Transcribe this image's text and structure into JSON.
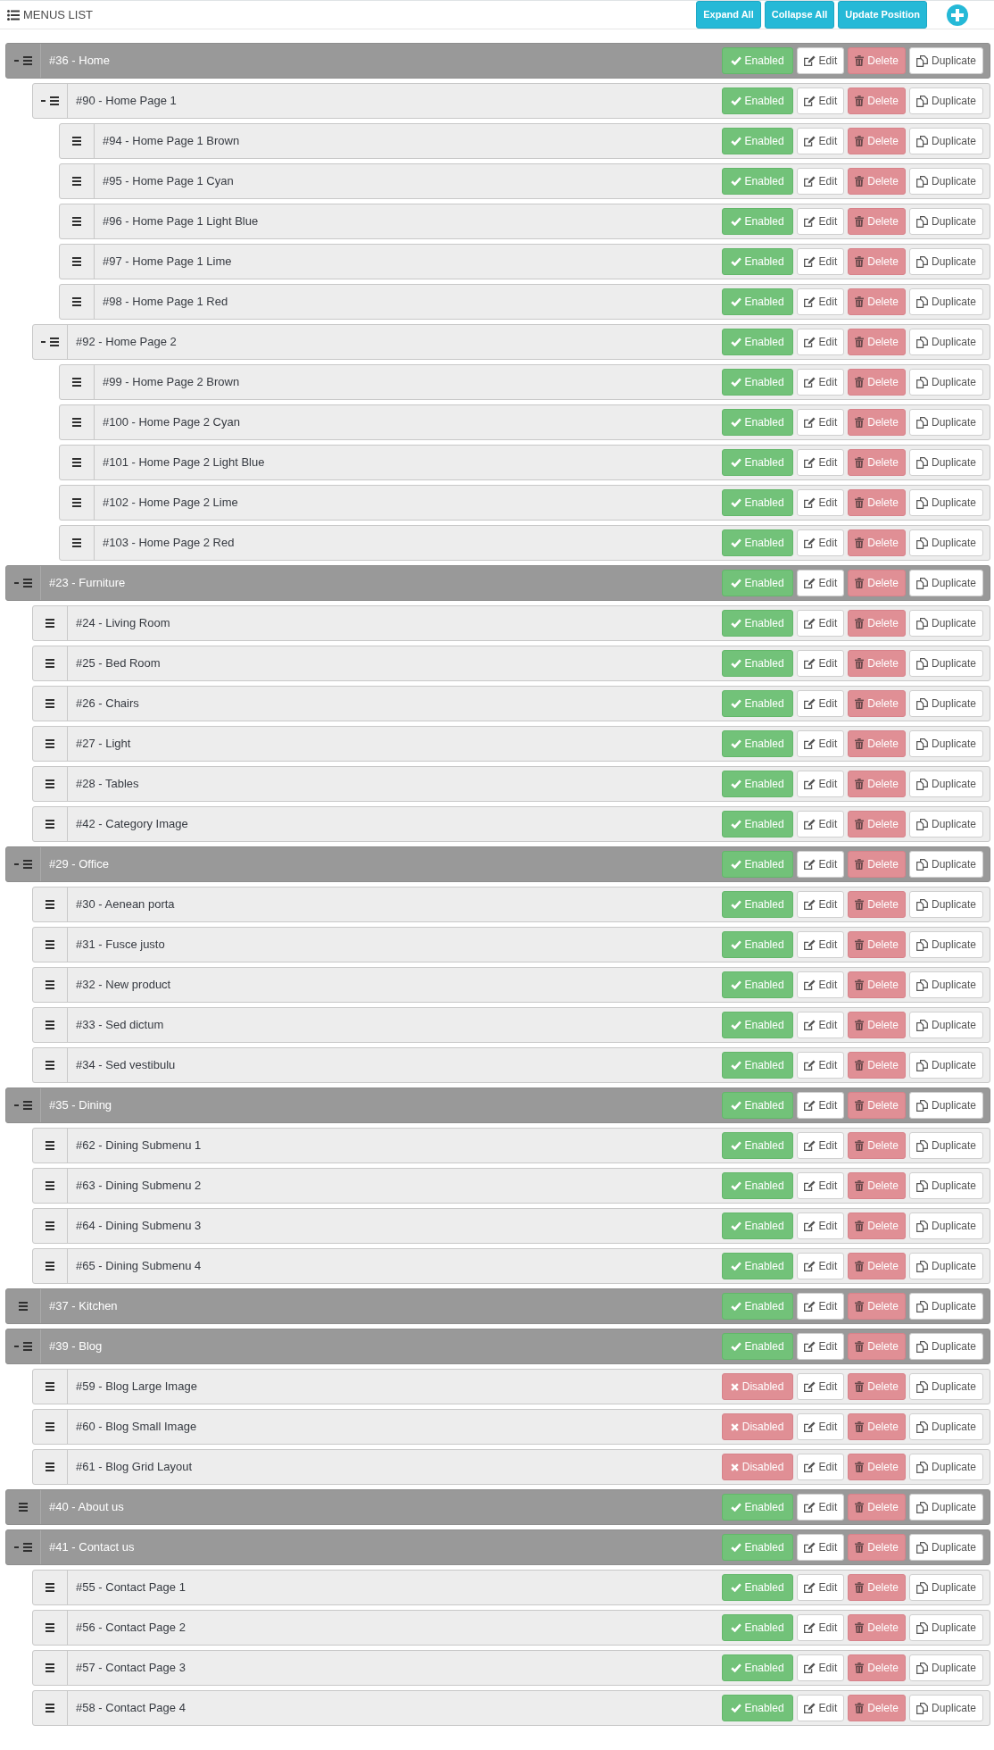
{
  "panel": {
    "title": "MENUS LIST",
    "buttons": [
      "Expand All",
      "Collapse All",
      "Update Position"
    ]
  },
  "items": [
    {
      "label": "#36 - Home",
      "enabled": true,
      "status": "Enabled",
      "edit": "Edit",
      "delete": "Delete",
      "duplicate": "Duplicate",
      "expanded": true,
      "children": [
        {
          "label": "#90 - Home Page 1",
          "enabled": true,
          "status": "Enabled",
          "edit": "Edit",
          "delete": "Delete",
          "duplicate": "Duplicate",
          "expanded": true,
          "children": [
            {
              "label": "#94 - Home Page 1 Brown",
              "enabled": true,
              "status": "Enabled",
              "edit": "Edit",
              "delete": "Delete",
              "duplicate": "Duplicate"
            },
            {
              "label": "#95 - Home Page 1 Cyan",
              "enabled": true,
              "status": "Enabled",
              "edit": "Edit",
              "delete": "Delete",
              "duplicate": "Duplicate"
            },
            {
              "label": "#96 - Home Page 1 Light Blue",
              "enabled": true,
              "status": "Enabled",
              "edit": "Edit",
              "delete": "Delete",
              "duplicate": "Duplicate"
            },
            {
              "label": "#97 - Home Page 1 Lime",
              "enabled": true,
              "status": "Enabled",
              "edit": "Edit",
              "delete": "Delete",
              "duplicate": "Duplicate"
            },
            {
              "label": "#98 - Home Page 1 Red",
              "enabled": true,
              "status": "Enabled",
              "edit": "Edit",
              "delete": "Delete",
              "duplicate": "Duplicate"
            }
          ]
        },
        {
          "label": "#92 - Home Page 2",
          "enabled": true,
          "status": "Enabled",
          "edit": "Edit",
          "delete": "Delete",
          "duplicate": "Duplicate",
          "expanded": true,
          "children": [
            {
              "label": "#99 - Home Page 2 Brown",
              "enabled": true,
              "status": "Enabled",
              "edit": "Edit",
              "delete": "Delete",
              "duplicate": "Duplicate"
            },
            {
              "label": "#100 - Home Page 2 Cyan",
              "enabled": true,
              "status": "Enabled",
              "edit": "Edit",
              "delete": "Delete",
              "duplicate": "Duplicate"
            },
            {
              "label": "#101 - Home Page 2 Light Blue",
              "enabled": true,
              "status": "Enabled",
              "edit": "Edit",
              "delete": "Delete",
              "duplicate": "Duplicate"
            },
            {
              "label": "#102 - Home Page 2 Lime",
              "enabled": true,
              "status": "Enabled",
              "edit": "Edit",
              "delete": "Delete",
              "duplicate": "Duplicate"
            },
            {
              "label": "#103 - Home Page 2 Red",
              "enabled": true,
              "status": "Enabled",
              "edit": "Edit",
              "delete": "Delete",
              "duplicate": "Duplicate"
            }
          ]
        }
      ]
    },
    {
      "label": "#23 - Furniture",
      "enabled": true,
      "status": "Enabled",
      "edit": "Edit",
      "delete": "Delete",
      "duplicate": "Duplicate",
      "expanded": true,
      "children": [
        {
          "label": "#24 - Living Room",
          "enabled": true,
          "status": "Enabled",
          "edit": "Edit",
          "delete": "Delete",
          "duplicate": "Duplicate"
        },
        {
          "label": "#25 - Bed Room",
          "enabled": true,
          "status": "Enabled",
          "edit": "Edit",
          "delete": "Delete",
          "duplicate": "Duplicate"
        },
        {
          "label": "#26 - Chairs",
          "enabled": true,
          "status": "Enabled",
          "edit": "Edit",
          "delete": "Delete",
          "duplicate": "Duplicate"
        },
        {
          "label": "#27 - Light",
          "enabled": true,
          "status": "Enabled",
          "edit": "Edit",
          "delete": "Delete",
          "duplicate": "Duplicate"
        },
        {
          "label": "#28 - Tables",
          "enabled": true,
          "status": "Enabled",
          "edit": "Edit",
          "delete": "Delete",
          "duplicate": "Duplicate"
        },
        {
          "label": "#42 - Category Image",
          "enabled": true,
          "status": "Enabled",
          "edit": "Edit",
          "delete": "Delete",
          "duplicate": "Duplicate"
        }
      ]
    },
    {
      "label": "#29 - Office",
      "enabled": true,
      "status": "Enabled",
      "edit": "Edit",
      "delete": "Delete",
      "duplicate": "Duplicate",
      "expanded": true,
      "children": [
        {
          "label": "#30 - Aenean porta",
          "enabled": true,
          "status": "Enabled",
          "edit": "Edit",
          "delete": "Delete",
          "duplicate": "Duplicate"
        },
        {
          "label": "#31 - Fusce justo",
          "enabled": true,
          "status": "Enabled",
          "edit": "Edit",
          "delete": "Delete",
          "duplicate": "Duplicate"
        },
        {
          "label": "#32 - New product",
          "enabled": true,
          "status": "Enabled",
          "edit": "Edit",
          "delete": "Delete",
          "duplicate": "Duplicate"
        },
        {
          "label": "#33 - Sed dictum",
          "enabled": true,
          "status": "Enabled",
          "edit": "Edit",
          "delete": "Delete",
          "duplicate": "Duplicate"
        },
        {
          "label": "#34 - Sed vestibulu",
          "enabled": true,
          "status": "Enabled",
          "edit": "Edit",
          "delete": "Delete",
          "duplicate": "Duplicate"
        }
      ]
    },
    {
      "label": "#35 - Dining",
      "enabled": true,
      "status": "Enabled",
      "edit": "Edit",
      "delete": "Delete",
      "duplicate": "Duplicate",
      "expanded": true,
      "children": [
        {
          "label": "#62 - Dining Submenu 1",
          "enabled": true,
          "status": "Enabled",
          "edit": "Edit",
          "delete": "Delete",
          "duplicate": "Duplicate"
        },
        {
          "label": "#63 - Dining Submenu 2",
          "enabled": true,
          "status": "Enabled",
          "edit": "Edit",
          "delete": "Delete",
          "duplicate": "Duplicate"
        },
        {
          "label": "#64 - Dining Submenu 3",
          "enabled": true,
          "status": "Enabled",
          "edit": "Edit",
          "delete": "Delete",
          "duplicate": "Duplicate"
        },
        {
          "label": "#65 - Dining Submenu 4",
          "enabled": true,
          "status": "Enabled",
          "edit": "Edit",
          "delete": "Delete",
          "duplicate": "Duplicate"
        }
      ]
    },
    {
      "label": "#37 - Kitchen",
      "enabled": true,
      "status": "Enabled",
      "edit": "Edit",
      "delete": "Delete",
      "duplicate": "Duplicate"
    },
    {
      "label": "#39 - Blog",
      "enabled": true,
      "status": "Enabled",
      "edit": "Edit",
      "delete": "Delete",
      "duplicate": "Duplicate",
      "expanded": true,
      "children": [
        {
          "label": "#59 - Blog Large Image",
          "enabled": false,
          "status": "Disabled",
          "edit": "Edit",
          "delete": "Delete",
          "duplicate": "Duplicate"
        },
        {
          "label": "#60 - Blog Small Image",
          "enabled": false,
          "status": "Disabled",
          "edit": "Edit",
          "delete": "Delete",
          "duplicate": "Duplicate"
        },
        {
          "label": "#61 - Blog Grid Layout",
          "enabled": false,
          "status": "Disabled",
          "edit": "Edit",
          "delete": "Delete",
          "duplicate": "Duplicate"
        }
      ]
    },
    {
      "label": "#40 - About us",
      "enabled": true,
      "status": "Enabled",
      "edit": "Edit",
      "delete": "Delete",
      "duplicate": "Duplicate"
    },
    {
      "label": "#41 - Contact us",
      "enabled": true,
      "status": "Enabled",
      "edit": "Edit",
      "delete": "Delete",
      "duplicate": "Duplicate",
      "expanded": true,
      "children": [
        {
          "label": "#55 - Contact Page 1",
          "enabled": true,
          "status": "Enabled",
          "edit": "Edit",
          "delete": "Delete",
          "duplicate": "Duplicate"
        },
        {
          "label": "#56 - Contact Page 2",
          "enabled": true,
          "status": "Enabled",
          "edit": "Edit",
          "delete": "Delete",
          "duplicate": "Duplicate"
        },
        {
          "label": "#57 - Contact Page 3",
          "enabled": true,
          "status": "Enabled",
          "edit": "Edit",
          "delete": "Delete",
          "duplicate": "Duplicate"
        },
        {
          "label": "#58 - Contact Page 4",
          "enabled": true,
          "status": "Enabled",
          "edit": "Edit",
          "delete": "Delete",
          "duplicate": "Duplicate"
        }
      ]
    }
  ]
}
